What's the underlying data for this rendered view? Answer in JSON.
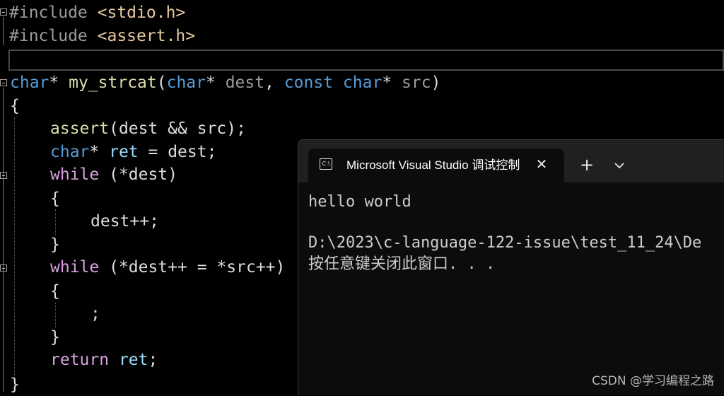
{
  "editor": {
    "code": {
      "l1_directive": "#include",
      "l1_header": "<stdio.h>",
      "l2_directive": "#include",
      "l2_header": "<assert.h>",
      "sig_ret_type": "char",
      "sig_star": "*",
      "sig_name": "my_strcat",
      "sig_open": "(",
      "sig_p1_type": "char",
      "sig_p1_star": "*",
      "sig_p1_name": "dest",
      "sig_comma": ",",
      "sig_const": "const",
      "sig_p2_type": "char",
      "sig_p2_star": "*",
      "sig_p2_name": "src",
      "sig_close": ")",
      "brace_open": "{",
      "assert_fn": "assert",
      "assert_args": "(dest && src);",
      "ret_type": "char",
      "ret_star": "*",
      "ret_name": "ret",
      "ret_assign": " = dest;",
      "while1_kw": "while",
      "while1_cond": "(*dest)",
      "while1_open": "{",
      "while1_body": "dest++;",
      "while1_close": "}",
      "while2_kw": "while",
      "while2_cond": "(*dest++ = *src++)",
      "while2_open": "{",
      "while2_body": ";",
      "while2_close": "}",
      "return_kw": "return",
      "return_val": "ret",
      "return_semi": ";",
      "brace_close": "}"
    }
  },
  "terminal": {
    "tab_title": "Microsoft Visual Studio 调试控制台",
    "tab_icon_glyph": "C:\\",
    "close_glyph": "✕",
    "new_tab_glyph": "+",
    "dropdown_icon": "chevron-down-icon",
    "output_line1": "hello world",
    "output_line2": "D:\\2023\\c-language-122-issue\\test_11_24\\De",
    "output_line3": "按任意键关闭此窗口. . ."
  },
  "watermark": "CSDN @学习编程之路",
  "colors": {
    "keyword": "#569cd6",
    "function": "#dcdcaa",
    "control": "#d8a0df",
    "string": "#e8c9a0",
    "variable": "#9cdcfe",
    "background": "#000000"
  }
}
